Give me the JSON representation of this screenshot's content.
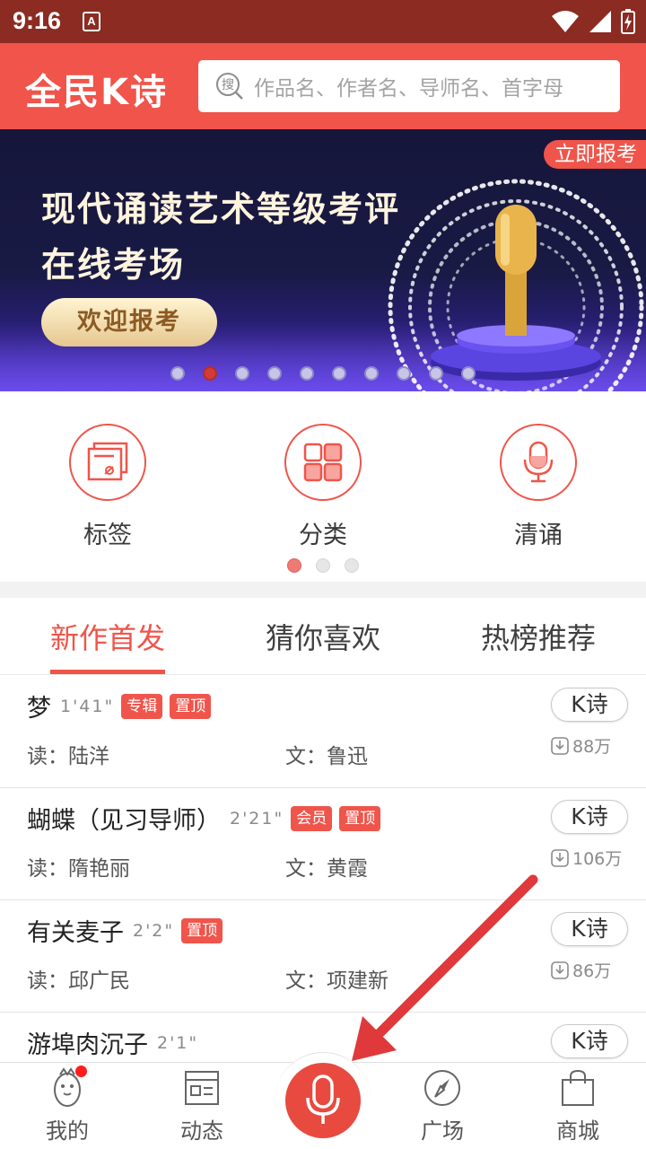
{
  "status_bar": {
    "time": "9:16",
    "notif_letter": "A"
  },
  "header": {
    "logo_text": "全民K诗",
    "search_icon_char": "搜",
    "search_placeholder": "作品名、作者名、导师名、首字母"
  },
  "banner": {
    "line1": "现代诵读艺术等级考评",
    "line2": "在线考场",
    "button": "欢迎报考",
    "tag": "立即报考",
    "slide_count": 10,
    "active_slide": 2
  },
  "quick_icons": [
    {
      "label": "标签",
      "icon": "tag-icon"
    },
    {
      "label": "分类",
      "icon": "grid-icon"
    },
    {
      "label": "清诵",
      "icon": "microphone-icon"
    }
  ],
  "quick_pages": {
    "count": 3,
    "active": 1
  },
  "tabs": [
    {
      "label": "新作首发",
      "active": true
    },
    {
      "label": "猜你喜欢",
      "active": false
    },
    {
      "label": "热榜推荐",
      "active": false
    }
  ],
  "list": [
    {
      "title": "梦",
      "duration": "1'41\"",
      "badges": [
        "专辑",
        "置顶"
      ],
      "reader": "读：陆洋",
      "writer": "文：鲁迅",
      "action": "K诗",
      "count": "88万"
    },
    {
      "title": "蝴蝶（见习导师）",
      "duration": "2'21\"",
      "badges": [
        "会员",
        "置顶"
      ],
      "reader": "读：隋艳丽",
      "writer": "文：黄霞",
      "action": "K诗",
      "count": "106万"
    },
    {
      "title": "有关麦子",
      "duration": "2'2\"",
      "badges": [
        "置顶"
      ],
      "reader": "读：邱广民",
      "writer": "文：项建新",
      "action": "K诗",
      "count": "86万"
    },
    {
      "title": "游埠肉沉子",
      "duration": "2'1\"",
      "badges": [],
      "reader": "",
      "writer": "",
      "action": "K诗",
      "count": ""
    }
  ],
  "bottom_nav": [
    {
      "label": "我的",
      "icon": "profile-mascot-icon"
    },
    {
      "label": "动态",
      "icon": "feed-icon"
    },
    {
      "label": "",
      "icon": "microphone-record-icon"
    },
    {
      "label": "广场",
      "icon": "compass-icon"
    },
    {
      "label": "商城",
      "icon": "shopping-bag-icon"
    }
  ],
  "colors": {
    "brand": "#f0544a",
    "status_bar": "#8b2b22",
    "annotation_arrow": "#e0393c"
  }
}
